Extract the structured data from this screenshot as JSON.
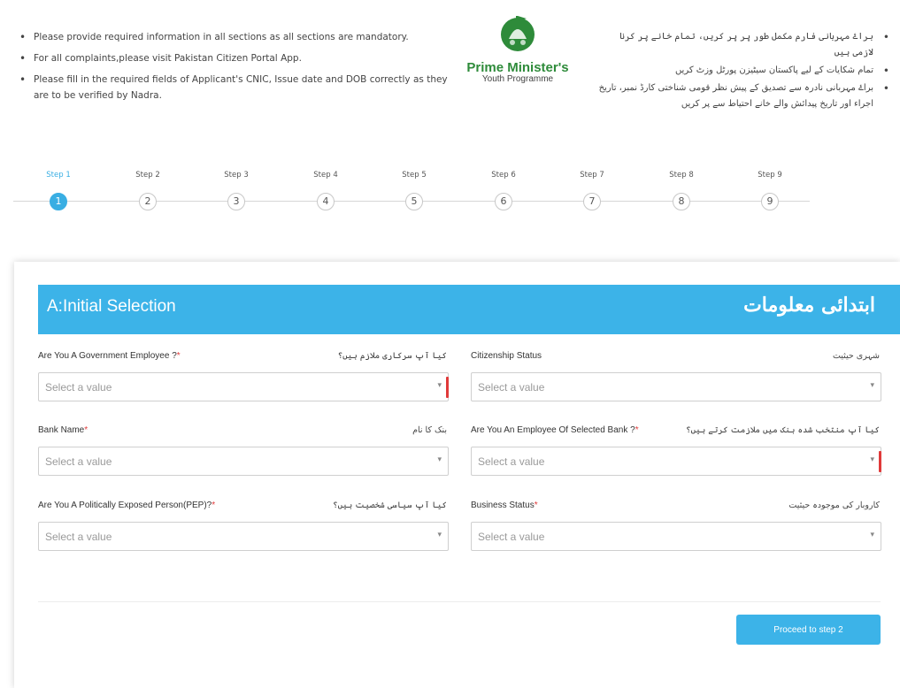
{
  "notes": {
    "en": [
      "Please provide required information in all sections as all sections are mandatory.",
      "For all complaints,please visit Pakistan Citizen Portal App.",
      "Please fill in the required fields of Applicant's CNIC, Issue date and DOB correctly as they are to be verified by Nadra."
    ],
    "ur": [
      "براۓ مہربانی فارم مکمل طور پر پر کریں، تمام خانے پر کرنا لازمی ہیں",
      "تمام شکایات کے لیے پاکستان سیٹیزن پورٹل وزٹ کریں",
      "براۓ مہربانی نادرہ سے تصدیق کے پیش نظر قومی شناختی کارڈ نمبر، تاریخ اجراء اور تاریخ پیدائش والے خانے احتیاط سے پر کریں"
    ]
  },
  "logo": {
    "title": "Prime Minister's",
    "subtitle": "Youth Programme",
    "colors": {
      "green": "#2e8b3a"
    }
  },
  "stepper": {
    "steps": [
      {
        "label": "Step 1",
        "number": "1",
        "active": true
      },
      {
        "label": "Step 2",
        "number": "2"
      },
      {
        "label": "Step 3",
        "number": "3"
      },
      {
        "label": "Step 4",
        "number": "4"
      },
      {
        "label": "Step 5",
        "number": "5"
      },
      {
        "label": "Step 6",
        "number": "6"
      },
      {
        "label": "Step 7",
        "number": "7"
      },
      {
        "label": "Step 8",
        "number": "8"
      },
      {
        "label": "Step 9",
        "number": "9"
      }
    ]
  },
  "section": {
    "title_en": "A:Initial Selection",
    "title_ur": "ابتدائی معلومات",
    "accent": "#3cb3e8"
  },
  "fields": [
    {
      "label_en": "Are You A Government Employee ?",
      "required": true,
      "label_ur": "کیا آپ سرکاری ملازم ہیں؟",
      "placeholder": "Select a value"
    },
    {
      "label_en": "Citizenship Status",
      "required": false,
      "label_ur": "شہری حیثیت",
      "placeholder": "Select a value"
    },
    {
      "label_en": "Bank Name",
      "required": true,
      "label_ur": "بنک کا نام",
      "placeholder": "Select a value"
    },
    {
      "label_en": "Are You An Employee Of Selected Bank ?",
      "required": true,
      "label_ur": "کیا آپ منتخب شدہ بنک میں ملازمت کرتے ہیں؟",
      "placeholder": "Select a value"
    },
    {
      "label_en": "Are You A Politically Exposed Person(PEP)?",
      "required": true,
      "label_ur": "کیا آپ سیاسی شخصیت ہیں؟",
      "placeholder": "Select a value"
    },
    {
      "label_en": "Business Status",
      "required": true,
      "label_ur": "کاروبار کی موجودہ حیثیت",
      "placeholder": "Select a value"
    }
  ],
  "required_marker": "*",
  "proceed_label": "Proceed to step 2"
}
